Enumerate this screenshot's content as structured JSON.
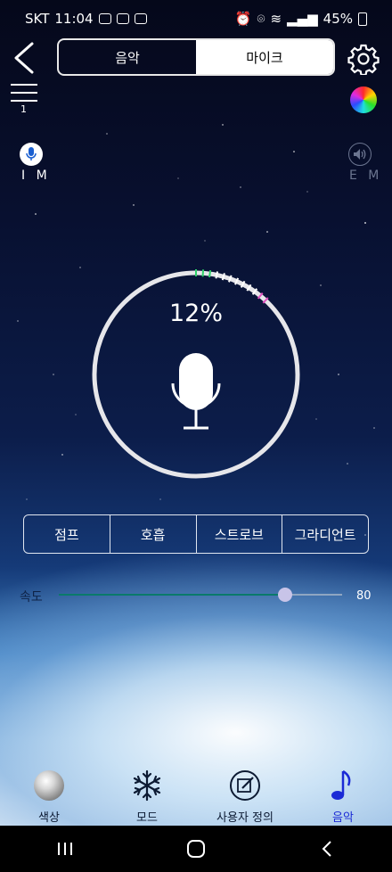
{
  "status_bar": {
    "carrier": "SKT",
    "time": "11:04",
    "battery": "45%"
  },
  "header": {
    "tabs": [
      {
        "label": "음악",
        "selected": false
      },
      {
        "label": "마이크",
        "selected": true
      }
    ]
  },
  "menu": {
    "count": "1"
  },
  "mic_source": {
    "internal_label": "I M",
    "external_label": "E M",
    "active": "internal"
  },
  "gauge": {
    "percent_text": "12%",
    "level": 0.12
  },
  "effects": [
    {
      "label": "점프"
    },
    {
      "label": "호흡"
    },
    {
      "label": "스트로브"
    },
    {
      "label": "그라디언트"
    }
  ],
  "speed": {
    "label": "속도",
    "value": "80",
    "fraction": 0.8
  },
  "bottom_nav": [
    {
      "label": "색상",
      "icon": "color-disk-icon",
      "active": false
    },
    {
      "label": "모드",
      "icon": "snowflake-icon",
      "active": false
    },
    {
      "label": "사용자 정의",
      "icon": "edit-icon",
      "active": false
    },
    {
      "label": "음악",
      "icon": "music-note-icon",
      "active": true
    }
  ],
  "colors": {
    "active_nav": "#1b2ad6",
    "slider_fill": "#0a7a6a",
    "gauge_ring": "#e6e6ea",
    "gauge_segment_green": "#2ed06a",
    "gauge_segment_pink": "#e24fc0"
  }
}
